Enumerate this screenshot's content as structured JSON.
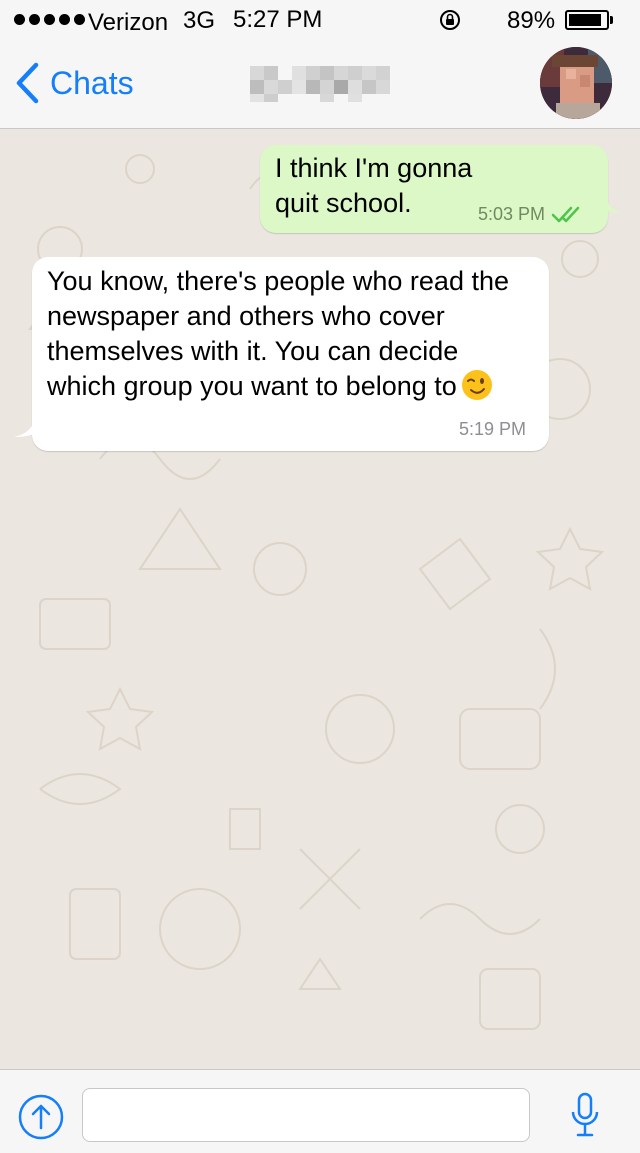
{
  "status_bar": {
    "carrier": "Verizon",
    "network": "3G",
    "time": "5:27 PM",
    "battery_percent_label": "89%",
    "battery_level": 0.89,
    "icons": [
      "signal-dots-icon",
      "rotation-lock-icon",
      "battery-icon"
    ]
  },
  "nav": {
    "back_label": "Chats",
    "back_icon": "chevron-left-icon",
    "accent_color": "#157efb"
  },
  "messages": [
    {
      "direction": "outgoing",
      "text": "I think I'm gonna quit school.",
      "time": "5:03 PM",
      "status_icon": "double-check-icon"
    },
    {
      "direction": "incoming",
      "text": "You know, there's people who read the newspaper and others who cover themselves with it. You can decide which group you want to belong to",
      "emoji": "winking-face-emoji",
      "time": "5:19 PM"
    }
  ],
  "input_bar": {
    "share_icon": "share-arrow-icon",
    "placeholder": "",
    "mic_icon": "microphone-icon"
  },
  "colors": {
    "outgoing_bubble": "#dcf8c6",
    "incoming_bubble": "#ffffff",
    "read_check": "#4fc44a",
    "chat_background": "#ebe6df"
  }
}
